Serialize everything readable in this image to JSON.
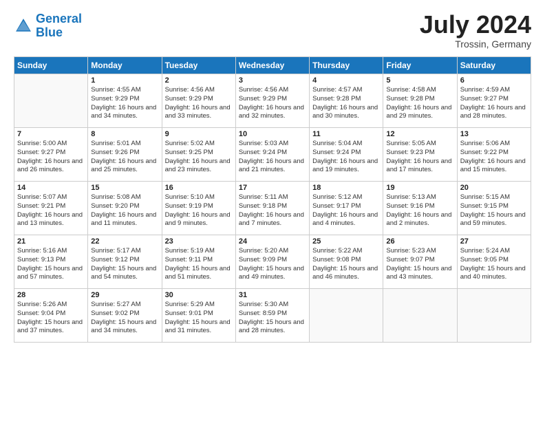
{
  "header": {
    "logo_line1": "General",
    "logo_line2": "Blue",
    "month_year": "July 2024",
    "location": "Trossin, Germany"
  },
  "days_of_week": [
    "Sunday",
    "Monday",
    "Tuesday",
    "Wednesday",
    "Thursday",
    "Friday",
    "Saturday"
  ],
  "weeks": [
    [
      {
        "day": "",
        "empty": true
      },
      {
        "day": "1",
        "sunrise": "Sunrise: 4:55 AM",
        "sunset": "Sunset: 9:29 PM",
        "daylight": "Daylight: 16 hours and 34 minutes."
      },
      {
        "day": "2",
        "sunrise": "Sunrise: 4:56 AM",
        "sunset": "Sunset: 9:29 PM",
        "daylight": "Daylight: 16 hours and 33 minutes."
      },
      {
        "day": "3",
        "sunrise": "Sunrise: 4:56 AM",
        "sunset": "Sunset: 9:29 PM",
        "daylight": "Daylight: 16 hours and 32 minutes."
      },
      {
        "day": "4",
        "sunrise": "Sunrise: 4:57 AM",
        "sunset": "Sunset: 9:28 PM",
        "daylight": "Daylight: 16 hours and 30 minutes."
      },
      {
        "day": "5",
        "sunrise": "Sunrise: 4:58 AM",
        "sunset": "Sunset: 9:28 PM",
        "daylight": "Daylight: 16 hours and 29 minutes."
      },
      {
        "day": "6",
        "sunrise": "Sunrise: 4:59 AM",
        "sunset": "Sunset: 9:27 PM",
        "daylight": "Daylight: 16 hours and 28 minutes."
      }
    ],
    [
      {
        "day": "7",
        "sunrise": "Sunrise: 5:00 AM",
        "sunset": "Sunset: 9:27 PM",
        "daylight": "Daylight: 16 hours and 26 minutes."
      },
      {
        "day": "8",
        "sunrise": "Sunrise: 5:01 AM",
        "sunset": "Sunset: 9:26 PM",
        "daylight": "Daylight: 16 hours and 25 minutes."
      },
      {
        "day": "9",
        "sunrise": "Sunrise: 5:02 AM",
        "sunset": "Sunset: 9:25 PM",
        "daylight": "Daylight: 16 hours and 23 minutes."
      },
      {
        "day": "10",
        "sunrise": "Sunrise: 5:03 AM",
        "sunset": "Sunset: 9:24 PM",
        "daylight": "Daylight: 16 hours and 21 minutes."
      },
      {
        "day": "11",
        "sunrise": "Sunrise: 5:04 AM",
        "sunset": "Sunset: 9:24 PM",
        "daylight": "Daylight: 16 hours and 19 minutes."
      },
      {
        "day": "12",
        "sunrise": "Sunrise: 5:05 AM",
        "sunset": "Sunset: 9:23 PM",
        "daylight": "Daylight: 16 hours and 17 minutes."
      },
      {
        "day": "13",
        "sunrise": "Sunrise: 5:06 AM",
        "sunset": "Sunset: 9:22 PM",
        "daylight": "Daylight: 16 hours and 15 minutes."
      }
    ],
    [
      {
        "day": "14",
        "sunrise": "Sunrise: 5:07 AM",
        "sunset": "Sunset: 9:21 PM",
        "daylight": "Daylight: 16 hours and 13 minutes."
      },
      {
        "day": "15",
        "sunrise": "Sunrise: 5:08 AM",
        "sunset": "Sunset: 9:20 PM",
        "daylight": "Daylight: 16 hours and 11 minutes."
      },
      {
        "day": "16",
        "sunrise": "Sunrise: 5:10 AM",
        "sunset": "Sunset: 9:19 PM",
        "daylight": "Daylight: 16 hours and 9 minutes."
      },
      {
        "day": "17",
        "sunrise": "Sunrise: 5:11 AM",
        "sunset": "Sunset: 9:18 PM",
        "daylight": "Daylight: 16 hours and 7 minutes."
      },
      {
        "day": "18",
        "sunrise": "Sunrise: 5:12 AM",
        "sunset": "Sunset: 9:17 PM",
        "daylight": "Daylight: 16 hours and 4 minutes."
      },
      {
        "day": "19",
        "sunrise": "Sunrise: 5:13 AM",
        "sunset": "Sunset: 9:16 PM",
        "daylight": "Daylight: 16 hours and 2 minutes."
      },
      {
        "day": "20",
        "sunrise": "Sunrise: 5:15 AM",
        "sunset": "Sunset: 9:15 PM",
        "daylight": "Daylight: 15 hours and 59 minutes."
      }
    ],
    [
      {
        "day": "21",
        "sunrise": "Sunrise: 5:16 AM",
        "sunset": "Sunset: 9:13 PM",
        "daylight": "Daylight: 15 hours and 57 minutes."
      },
      {
        "day": "22",
        "sunrise": "Sunrise: 5:17 AM",
        "sunset": "Sunset: 9:12 PM",
        "daylight": "Daylight: 15 hours and 54 minutes."
      },
      {
        "day": "23",
        "sunrise": "Sunrise: 5:19 AM",
        "sunset": "Sunset: 9:11 PM",
        "daylight": "Daylight: 15 hours and 51 minutes."
      },
      {
        "day": "24",
        "sunrise": "Sunrise: 5:20 AM",
        "sunset": "Sunset: 9:09 PM",
        "daylight": "Daylight: 15 hours and 49 minutes."
      },
      {
        "day": "25",
        "sunrise": "Sunrise: 5:22 AM",
        "sunset": "Sunset: 9:08 PM",
        "daylight": "Daylight: 15 hours and 46 minutes."
      },
      {
        "day": "26",
        "sunrise": "Sunrise: 5:23 AM",
        "sunset": "Sunset: 9:07 PM",
        "daylight": "Daylight: 15 hours and 43 minutes."
      },
      {
        "day": "27",
        "sunrise": "Sunrise: 5:24 AM",
        "sunset": "Sunset: 9:05 PM",
        "daylight": "Daylight: 15 hours and 40 minutes."
      }
    ],
    [
      {
        "day": "28",
        "sunrise": "Sunrise: 5:26 AM",
        "sunset": "Sunset: 9:04 PM",
        "daylight": "Daylight: 15 hours and 37 minutes."
      },
      {
        "day": "29",
        "sunrise": "Sunrise: 5:27 AM",
        "sunset": "Sunset: 9:02 PM",
        "daylight": "Daylight: 15 hours and 34 minutes."
      },
      {
        "day": "30",
        "sunrise": "Sunrise: 5:29 AM",
        "sunset": "Sunset: 9:01 PM",
        "daylight": "Daylight: 15 hours and 31 minutes."
      },
      {
        "day": "31",
        "sunrise": "Sunrise: 5:30 AM",
        "sunset": "Sunset: 8:59 PM",
        "daylight": "Daylight: 15 hours and 28 minutes."
      },
      {
        "day": "",
        "empty": true
      },
      {
        "day": "",
        "empty": true
      },
      {
        "day": "",
        "empty": true
      }
    ]
  ]
}
